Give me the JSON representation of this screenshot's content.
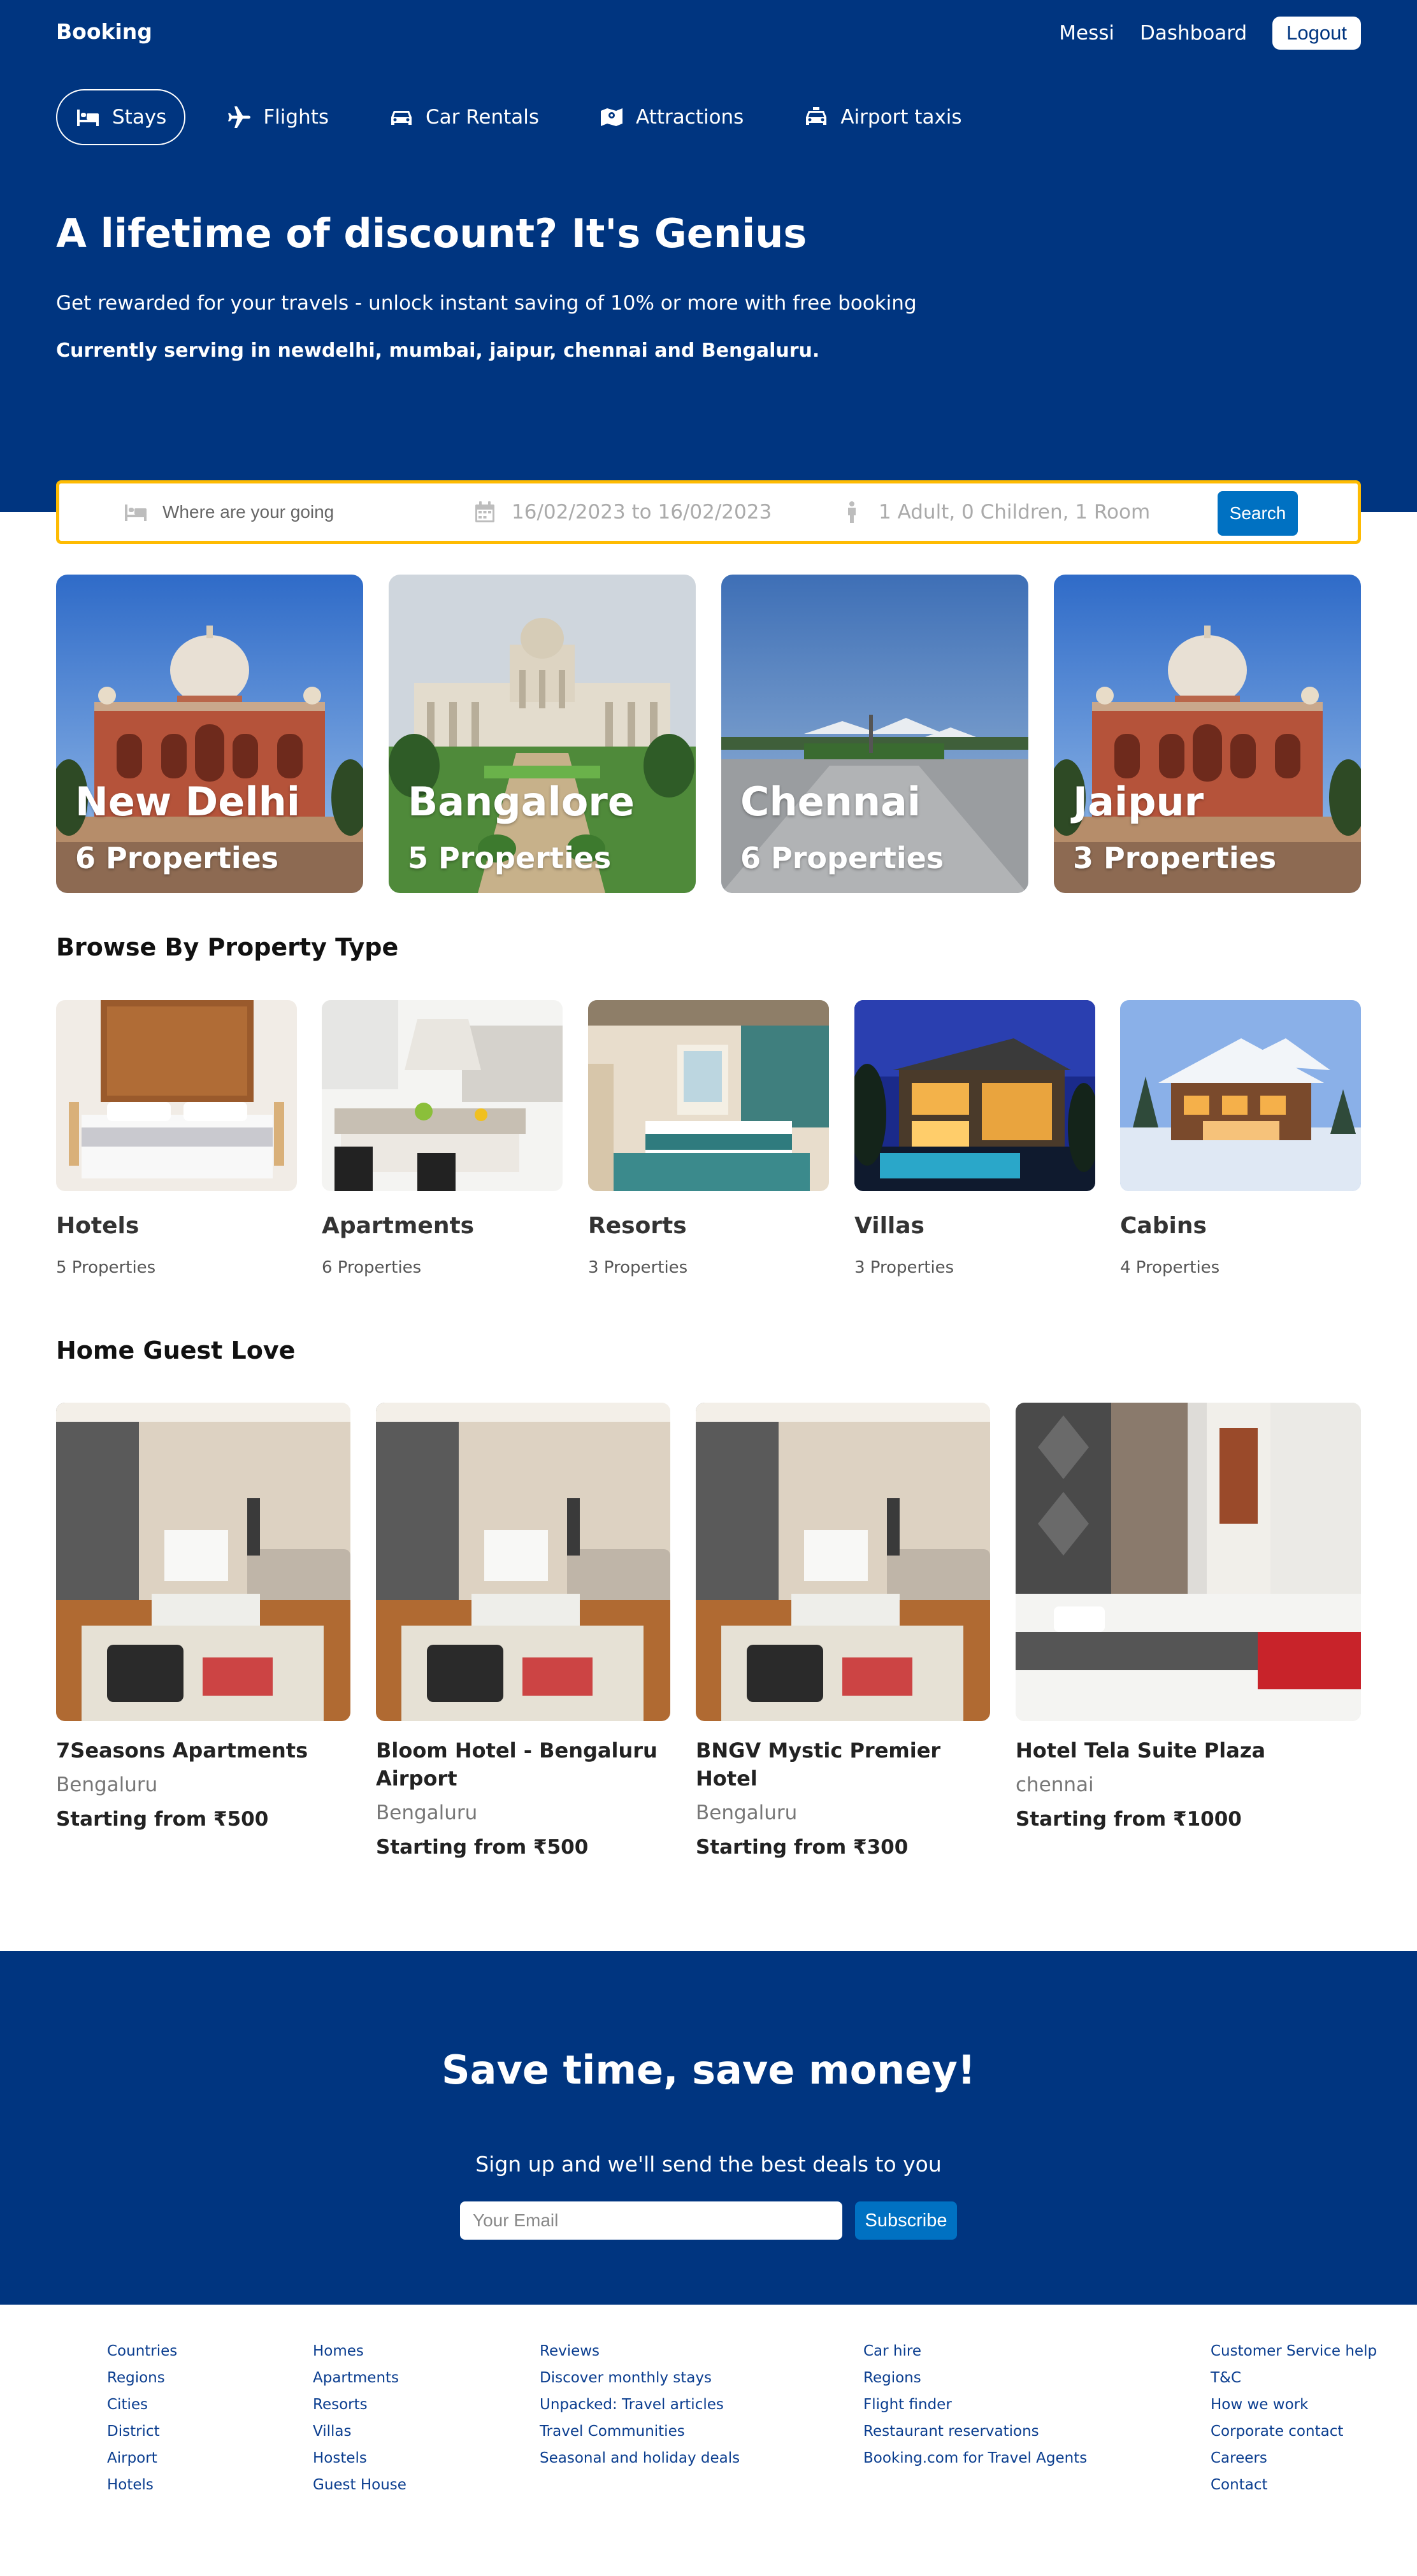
{
  "header": {
    "brand": "Booking",
    "user": "Messi",
    "dashboard": "Dashboard",
    "logout": "Logout"
  },
  "tabs": [
    {
      "label": "Stays",
      "icon": "bed-icon",
      "active": true
    },
    {
      "label": "Flights",
      "icon": "plane-icon"
    },
    {
      "label": "Car Rentals",
      "icon": "car-icon"
    },
    {
      "label": "Attractions",
      "icon": "map-icon"
    },
    {
      "label": "Airport taxis",
      "icon": "taxi-icon"
    }
  ],
  "hero": {
    "title": "A lifetime of discount? It's Genius",
    "subtitle": "Get rewarded for your travels - unlock instant saving of 10% or more with free booking",
    "serving": "Currently serving in newdelhi, mumbai, jaipur, chennai and Bengaluru."
  },
  "search": {
    "destination_placeholder": "Where are your going",
    "dates": "16/02/2023 to 16/02/2023",
    "guests": "1 Adult, 0 Children, 1 Room",
    "button": "Search"
  },
  "cities": [
    {
      "name": "New Delhi",
      "count": "6 Properties"
    },
    {
      "name": "Bangalore",
      "count": "5 Properties"
    },
    {
      "name": "Chennai",
      "count": "6 Properties"
    },
    {
      "name": "Jaipur",
      "count": "3 Properties"
    }
  ],
  "property_types": {
    "title": "Browse By Property Type",
    "items": [
      {
        "name": "Hotels",
        "count": "5 Properties"
      },
      {
        "name": "Apartments",
        "count": "6 Properties"
      },
      {
        "name": "Resorts",
        "count": "3 Properties"
      },
      {
        "name": "Villas",
        "count": "3 Properties"
      },
      {
        "name": "Cabins",
        "count": "4 Properties"
      }
    ]
  },
  "guest_love": {
    "title": "Home Guest Love",
    "items": [
      {
        "name": "7Seasons Apartments",
        "city": "Bengaluru",
        "price": "Starting from ₹500"
      },
      {
        "name": "Bloom Hotel - Bengaluru Airport",
        "city": "Bengaluru",
        "price": "Starting from ₹500"
      },
      {
        "name": "BNGV Mystic Premier Hotel",
        "city": "Bengaluru",
        "price": "Starting from ₹300"
      },
      {
        "name": "Hotel Tela Suite Plaza",
        "city": "chennai",
        "price": "Starting from ₹1000"
      }
    ]
  },
  "newsletter": {
    "title": "Save time, save money!",
    "subtitle": "Sign up and we'll send the best deals to you",
    "placeholder": "Your Email",
    "button": "Subscribe"
  },
  "footer": {
    "col1": [
      "Countries",
      "Regions",
      "Cities",
      "District",
      "Airport",
      "Hotels"
    ],
    "col2": [
      "Homes",
      "Apartments",
      "Resorts",
      "Villas",
      "Hostels",
      "Guest House"
    ],
    "col3": [
      "Reviews",
      "Discover monthly stays",
      "Unpacked: Travel articles",
      "Travel Communities",
      "Seasonal and holiday deals"
    ],
    "col4": [
      "Car hire",
      "Regions",
      "Flight finder",
      "Restaurant reservations",
      "Booking.com for Travel Agents"
    ],
    "col5": [
      "Customer Service help",
      "T&C",
      "How we work",
      "Corporate contact",
      "Careers",
      "Contact"
    ]
  },
  "colors": {
    "brand_blue": "#003580",
    "action_blue": "#0071c2",
    "search_border": "#febb02"
  }
}
